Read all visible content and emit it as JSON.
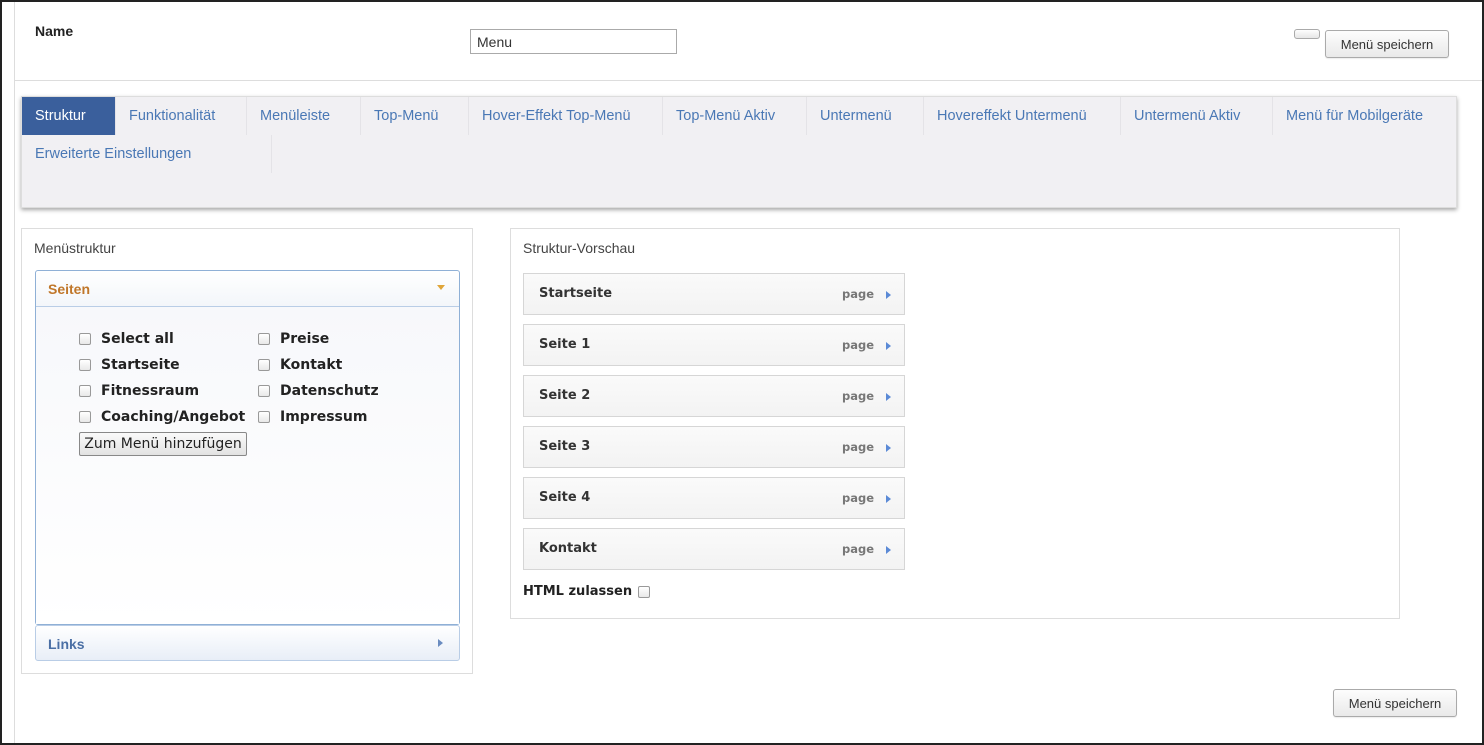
{
  "header": {
    "name_label": "Name",
    "name_value": "Menu",
    "save_label": "Menü speichern"
  },
  "tabs": [
    {
      "label": "Struktur",
      "active": true
    },
    {
      "label": "Funktionalität"
    },
    {
      "label": "Menüleiste"
    },
    {
      "label": "Top-Menü"
    },
    {
      "label": "Hover-Effekt Top-Menü"
    },
    {
      "label": "Top-Menü Aktiv"
    },
    {
      "label": "Untermenü"
    },
    {
      "label": "Hovereffekt Untermenü"
    },
    {
      "label": "Untermenü Aktiv"
    },
    {
      "label": "Menü für Mobilgeräte"
    },
    {
      "label": "Erweiterte Einstellungen"
    }
  ],
  "menu_structure": {
    "title": "Menüstruktur",
    "pages_section": {
      "title": "Seiten",
      "items": [
        "Select all",
        "Startseite",
        "Fitnessraum",
        "Coaching/Angebot",
        "Preise",
        "Kontakt",
        "Datenschutz",
        "Impressum"
      ],
      "add_button": "Zum Menü hinzufügen"
    },
    "links_section": {
      "title": "Links"
    }
  },
  "preview": {
    "title": "Struktur-Vorschau",
    "items": [
      {
        "label": "Startseite",
        "type": "page"
      },
      {
        "label": "Seite 1",
        "type": "page"
      },
      {
        "label": "Seite 2",
        "type": "page"
      },
      {
        "label": "Seite 3",
        "type": "page"
      },
      {
        "label": "Seite 4",
        "type": "page"
      },
      {
        "label": "Kontakt",
        "type": "page"
      }
    ],
    "allow_html_label": "HTML zulassen"
  },
  "footer": {
    "save_label": "Menü speichern"
  }
}
